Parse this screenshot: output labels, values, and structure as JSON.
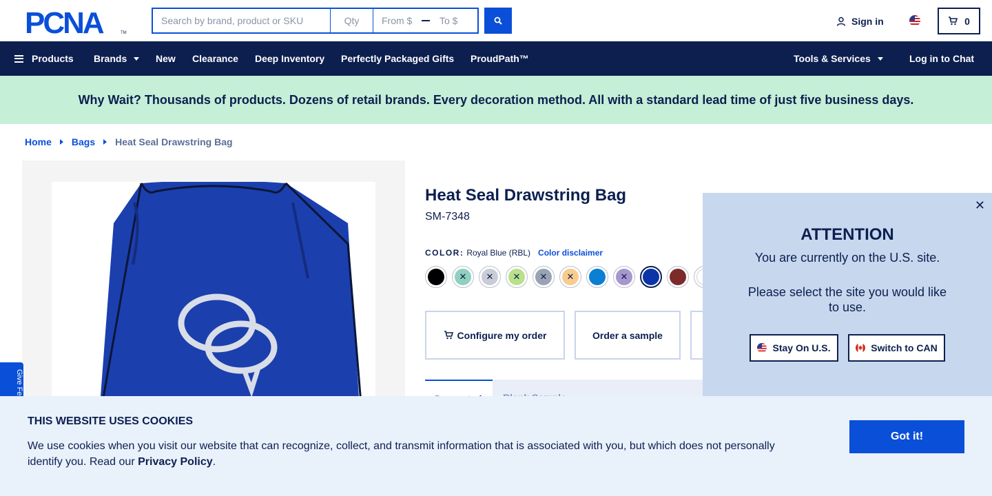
{
  "header": {
    "logo_text": "PCNA",
    "search_placeholder": "Search by brand, product or SKU",
    "qty_placeholder": "Qty",
    "from_placeholder": "From $",
    "to_placeholder": "To $",
    "signin_label": "Sign in",
    "cart_count": "0"
  },
  "nav": {
    "products": "Products",
    "brands": "Brands",
    "new": "New",
    "clearance": "Clearance",
    "deep_inventory": "Deep Inventory",
    "gifts": "Perfectly Packaged Gifts",
    "proudpath": "ProudPath™",
    "tools": "Tools & Services",
    "chat": "Log in to Chat"
  },
  "banner": {
    "text": "Why Wait? Thousands of products. Dozens of retail brands. Every decoration method. All with a standard lead time of just five business days."
  },
  "breadcrumb": {
    "home": "Home",
    "bags": "Bags",
    "current": "Heat Seal Drawstring Bag"
  },
  "feedback_label": "Give Fe",
  "product": {
    "title": "Heat Seal Drawstring Bag",
    "sku": "SM-7348",
    "color_label": "COLOR:",
    "color_value": "Royal Blue (RBL)",
    "color_disclaimer": "Color disclaimer",
    "swatches": [
      {
        "color": "#000000",
        "unavailable": false
      },
      {
        "color": "#8fd0bf",
        "unavailable": true
      },
      {
        "color": "#c9ccd6",
        "unavailable": true
      },
      {
        "color": "#b9e08a",
        "unavailable": true
      },
      {
        "color": "#9aa3b3",
        "unavailable": true
      },
      {
        "color": "#f8cc8f",
        "unavailable": true
      },
      {
        "color": "#0a7fd4",
        "unavailable": false
      },
      {
        "color": "#a797cf",
        "unavailable": true
      },
      {
        "color": "#0a34a8",
        "unavailable": false,
        "selected": true
      },
      {
        "color": "#7d2a2a",
        "unavailable": false
      },
      {
        "color": "#ffffff",
        "unavailable": false
      }
    ],
    "configure_label": "Configure my order",
    "sample_label": "Order a sample",
    "tab_active": "Decorated",
    "tab_2": "Blank   Sample"
  },
  "modal": {
    "title": "ATTENTION",
    "line1": "You are currently on the U.S. site.",
    "line2": "Please select the site you would like to use.",
    "stay_label": "Stay On U.S.",
    "switch_label": "Switch to CAN"
  },
  "cookie": {
    "title": "THIS WEBSITE USES COOKIES",
    "text": "We use cookies when you visit our website that can recognize, collect, and transmit information that is associated with you, but which does not personally identify you. Read our",
    "link": "Privacy Policy",
    "end": ".",
    "button": "Got it!"
  }
}
